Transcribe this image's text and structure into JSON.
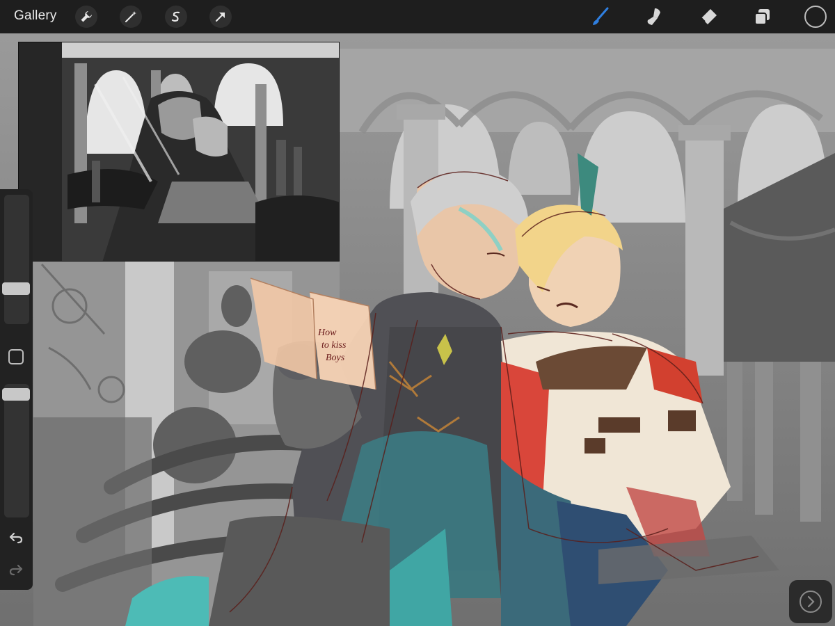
{
  "app": {
    "gallery_label": "Gallery"
  },
  "toolbar": {
    "actions": [
      {
        "name": "wrench-icon",
        "label": "Actions"
      },
      {
        "name": "magic-wand-icon",
        "label": "Adjustments"
      },
      {
        "name": "selection-icon",
        "label": "Selection"
      },
      {
        "name": "transform-arrow-icon",
        "label": "Transform"
      }
    ],
    "tools": [
      {
        "name": "brush-icon",
        "active": true
      },
      {
        "name": "smudge-icon",
        "active": false
      },
      {
        "name": "eraser-icon",
        "active": false
      },
      {
        "name": "layers-icon",
        "active": false
      }
    ],
    "active_color": "#1e1e1e",
    "accent_color": "#2f7fe0"
  },
  "sidebar": {
    "brush_size_level": 0.46,
    "brush_opacity_level": 0.1,
    "undo_icon": "undo-icon",
    "redo_icon": "redo-icon"
  },
  "artwork": {
    "book_text": [
      "How",
      "to kiss",
      "Boys"
    ]
  }
}
